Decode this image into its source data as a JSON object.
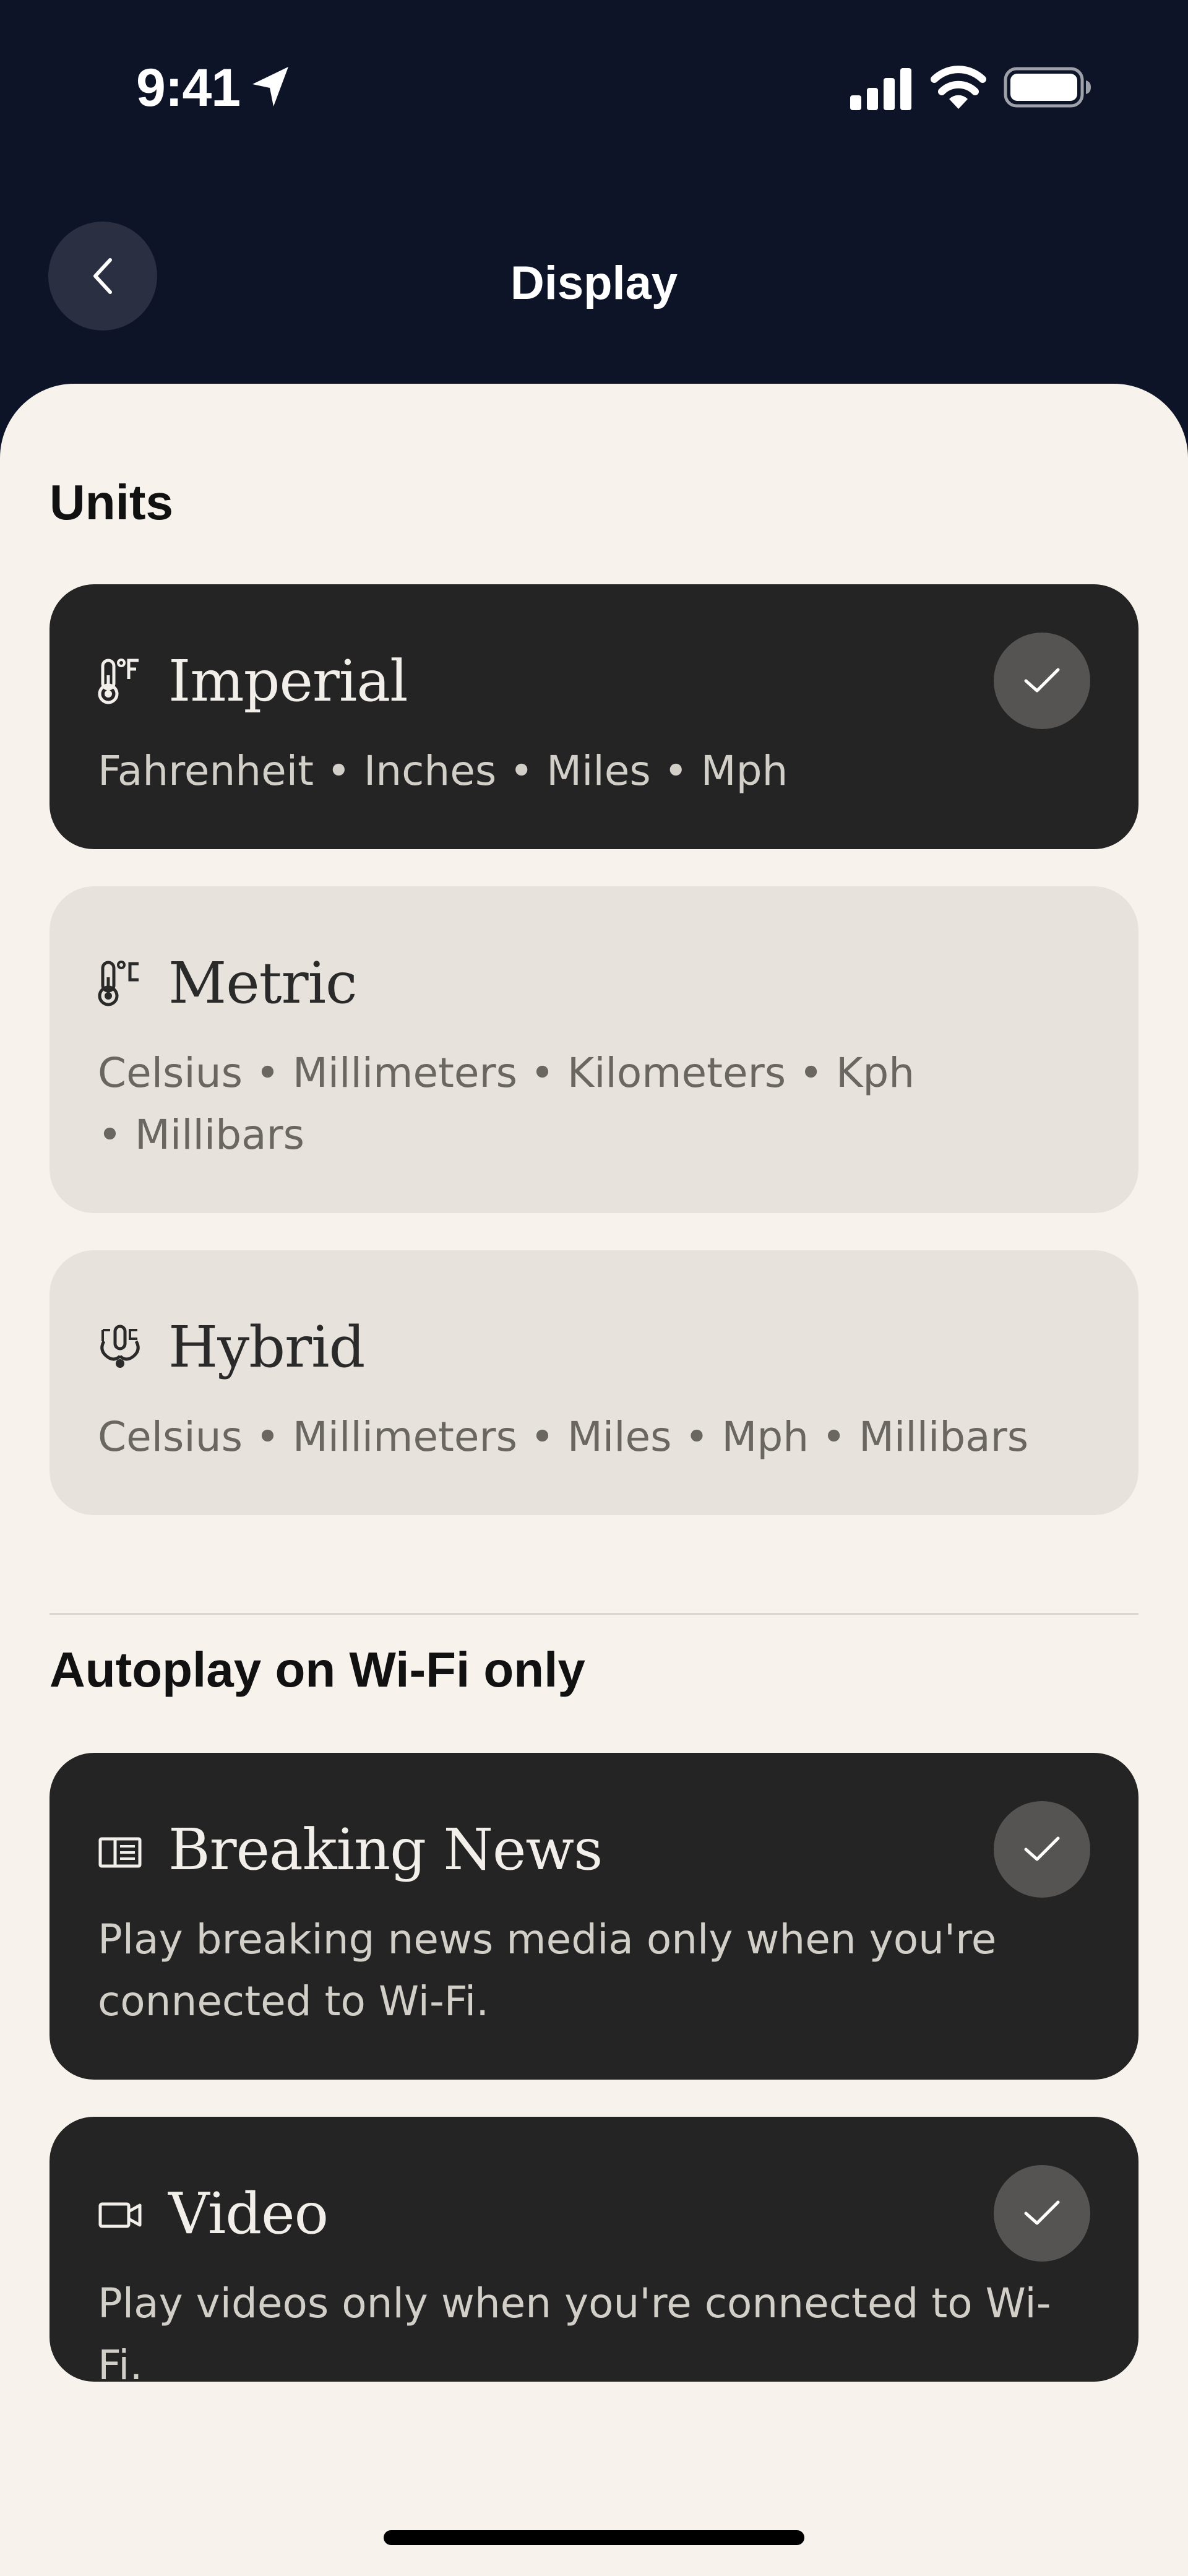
{
  "status_bar": {
    "time": "9:41",
    "icons": [
      "location-arrow-icon",
      "signal-icon",
      "wifi-icon",
      "battery-icon"
    ]
  },
  "header": {
    "title": "Display",
    "back_icon": "chevron-left-icon"
  },
  "units": {
    "heading": "Units",
    "options": [
      {
        "title": "Imperial",
        "description": "Fahrenheit • Inches • Miles • Mph",
        "icon": "thermometer-fahrenheit-icon",
        "selected": true
      },
      {
        "title": "Metric",
        "description": "Celsius • Millimeters • Kilometers • Kph • Millibars",
        "icon": "thermometer-celsius-icon",
        "selected": false
      },
      {
        "title": "Hybrid",
        "description": "Celsius • Millimeters • Miles • Mph • Millibars",
        "icon": "hybrid-units-icon",
        "selected": false
      }
    ]
  },
  "autoplay": {
    "heading": "Autoplay on Wi-Fi only",
    "options": [
      {
        "title": "Breaking News",
        "description": "Play breaking news media only when you're connected to Wi-Fi.",
        "icon": "newspaper-icon",
        "selected": true
      },
      {
        "title": "Video",
        "description": "Play videos only when you're connected to Wi-Fi.",
        "icon": "video-camera-icon",
        "selected": true
      }
    ]
  },
  "colors": {
    "header_background": "#0e1428",
    "sheet_background": "#f7f2ec",
    "selected_card": "#252424",
    "unselected_card": "#e8e2dc",
    "check_circle": "#555453"
  }
}
